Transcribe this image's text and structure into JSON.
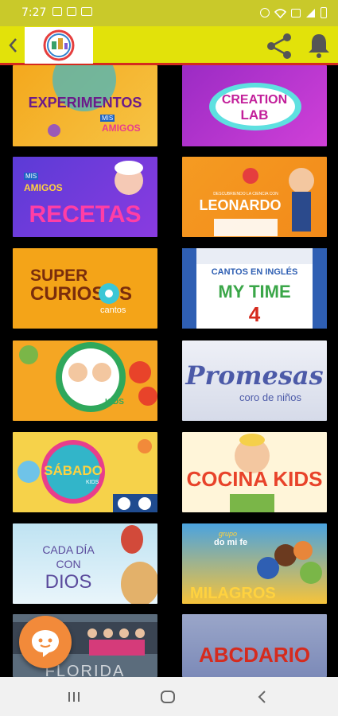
{
  "status_bar": {
    "time": "7:27",
    "icons_left": [
      "photo-icon",
      "gallery-icon",
      "cast-icon"
    ],
    "icons_right": [
      "alarm-icon",
      "wifi-icon",
      "signal-icon",
      "battery-icon"
    ]
  },
  "colors": {
    "status_bar": "#c9c92a",
    "app_bar": "#e2e20a",
    "accent_line": "#d52b1e",
    "fab": "#f28a3a",
    "nav_bar": "#f1f1f1"
  },
  "tiles": {
    "experimentos": {
      "title": "EXPERIMENTOS",
      "badge_top": "MIS",
      "badge": "AMIGOS"
    },
    "creation_lab": {
      "title": "CREATION",
      "title2": "LAB"
    },
    "recetas": {
      "badge_top": "MIS",
      "badge": "AMIGOS",
      "title": "RECETAS"
    },
    "leonardo": {
      "subtitle": "DESCUBRIENDO LA CIENCIA CON",
      "title": "LEONARDO"
    },
    "super_curiosos": {
      "title": "SUPER",
      "title2": "CURIOSOS",
      "subtitle": "cantos"
    },
    "my_time": {
      "subtitle": "CANTOS EN INGLÉS",
      "title": "MY TIME",
      "number": "4"
    },
    "cocina_kids_1": {
      "label": "KIDS"
    },
    "promesas": {
      "title": "Promesas",
      "subtitle": "coro de niños"
    },
    "sabado": {
      "title": "SÁBADO",
      "subtitle": "KIDS"
    },
    "cocina_kids_2": {
      "title": "COCINA KIDS"
    },
    "cada_dia": {
      "title": "CADA DÍA",
      "title2": "CON",
      "title3": "DIOS"
    },
    "milagros": {
      "badge": "grupo",
      "badge2": "do mi fe",
      "title": "MILAGROS"
    },
    "florida": {
      "title": "FLORIDA"
    },
    "abcdario": {
      "title": "ABCDARIO"
    }
  }
}
